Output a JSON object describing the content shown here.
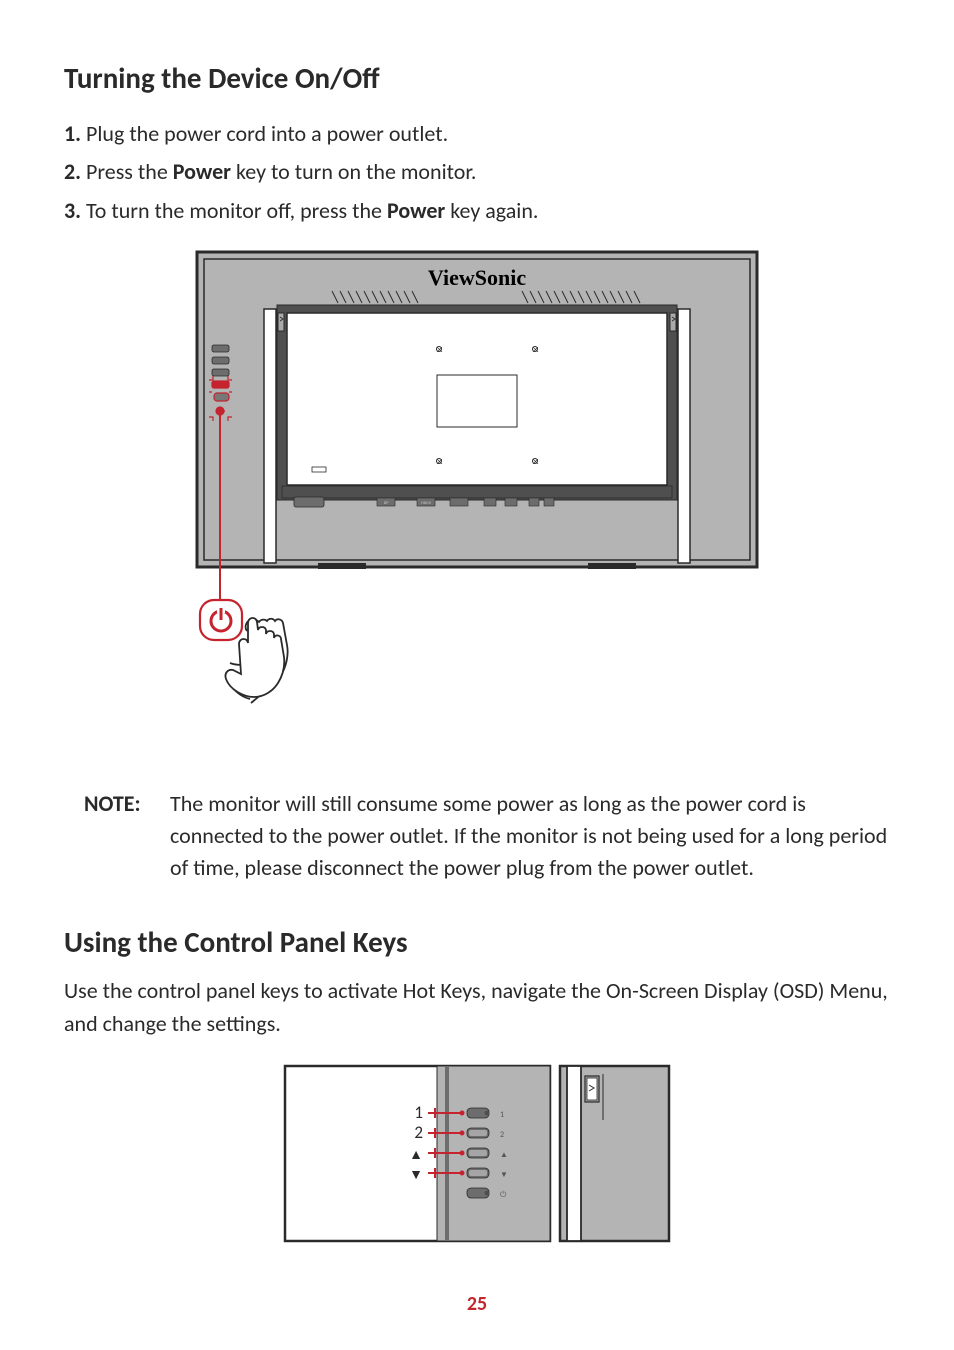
{
  "section1": {
    "heading": "Turning the Device On/Off",
    "steps": [
      {
        "num": "1.",
        "parts": [
          "Plug the power cord into a power outlet."
        ]
      },
      {
        "num": "2.",
        "parts": [
          "Press the ",
          "Power",
          " key to turn on the monitor."
        ]
      },
      {
        "num": "3.",
        "parts": [
          "To turn the monitor off, press the ",
          "Power",
          " key again."
        ]
      }
    ],
    "monitor_brand": "ViewSonic"
  },
  "note": {
    "label": "NOTE:",
    "text": "The monitor will still consume some power as long as the power cord is connected to the power outlet. If the monitor is not being used for a long period of time, please disconnect the power plug from the power outlet."
  },
  "section2": {
    "heading": "Using the Control Panel Keys",
    "para": "Use the control panel keys to activate Hot Keys, navigate the On-Screen Display (OSD) Menu, and change the settings.",
    "key_labels": [
      "1",
      "2",
      "▲",
      "▼"
    ],
    "port_markers": [
      "1",
      "2",
      "▲",
      "▼",
      "⏻"
    ]
  },
  "page_number": "25"
}
